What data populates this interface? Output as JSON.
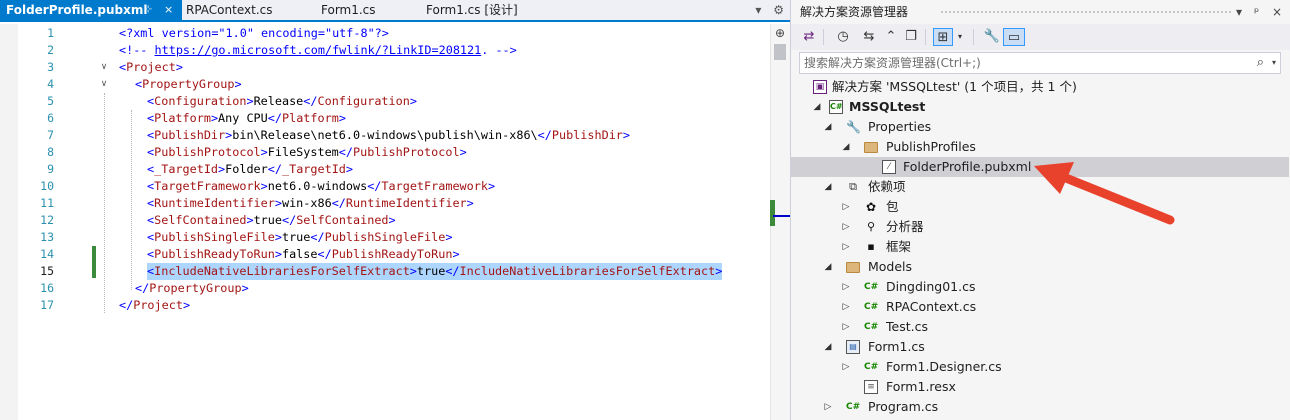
{
  "editor": {
    "tabs": [
      {
        "label": "FolderProfile.pubxml",
        "active": true
      },
      {
        "label": "RPAContext.cs",
        "active": false
      },
      {
        "label": "Form1.cs",
        "active": false
      },
      {
        "label": "Form1.cs [设计]",
        "active": false
      }
    ],
    "tab_pin": "⊹",
    "tab_close": "×",
    "tab_overflow": "▾",
    "tab_settings": "⚙",
    "split_button": "⊕",
    "current_line": 15,
    "line_numbers": [
      "1",
      "2",
      "3",
      "4",
      "5",
      "6",
      "7",
      "8",
      "9",
      "10",
      "11",
      "12",
      "13",
      "14",
      "15",
      "16",
      "17"
    ],
    "lines": {
      "l1_a": "<?xml version=\"1.0\" encoding=\"utf-8\"?>",
      "l2_a": "<!-- ",
      "l2_link": "https://go.microsoft.com/fwlink/?LinkID=208121",
      "l2_b": ". -->",
      "l3_a": "<",
      "l3_tag": "Project",
      "l3_b": ">",
      "l4_a": "<",
      "l4_tag": "PropertyGroup",
      "l4_b": ">",
      "l5_open": "Configuration",
      "l5_val": "Release",
      "l6_open": "Platform",
      "l6_val": "Any CPU",
      "l7_open": "PublishDir",
      "l7_val": "bin\\Release\\net6.0-windows\\publish\\win-x86\\",
      "l8_open": "PublishProtocol",
      "l8_val": "FileSystem",
      "l9_open": "_TargetId",
      "l9_val": "Folder",
      "l10_open": "TargetFramework",
      "l10_val": "net6.0-windows",
      "l11_open": "RuntimeIdentifier",
      "l11_val": "win-x86",
      "l12_open": "SelfContained",
      "l12_val": "true",
      "l13_open": "PublishSingleFile",
      "l13_val": "true",
      "l14_open": "PublishReadyToRun",
      "l14_val": "false",
      "l15_open": "IncludeNativeLibrariesForSelfExtract",
      "l15_val": "true",
      "l16_tag": "PropertyGroup",
      "l17_tag": "Project"
    }
  },
  "solution_explorer": {
    "title": "解决方案资源管理器",
    "title_buttons": [
      "▾",
      "ᵖ",
      "×"
    ],
    "toolbar_icons": [
      "solution-switch",
      "history",
      "sync",
      "collapse",
      "copy",
      "view-toggle",
      "properties",
      "preview"
    ],
    "toolbar_glyphs": [
      "⇄",
      "◷",
      "⇆",
      "⌃",
      "❐",
      "⊞",
      "🔧",
      "▭"
    ],
    "search_placeholder": "搜索解决方案资源管理器(Ctrl+;)",
    "search_icon": "⌕",
    "search_dropdown": "▾",
    "tree": [
      {
        "label": "解决方案 'MSSQLtest' (1 个项目，共 1 个)",
        "level": 0,
        "arrow": "",
        "icon": "sln"
      },
      {
        "label": "MSSQLtest",
        "level": 0,
        "arrow": "◢",
        "icon": "csproj",
        "bold": true
      },
      {
        "label": "Properties",
        "level": 1,
        "arrow": "◢",
        "icon": "wrench"
      },
      {
        "label": "PublishProfiles",
        "level": 2,
        "arrow": "◢",
        "icon": "folder"
      },
      {
        "label": "FolderProfile.pubxml",
        "level": 3,
        "arrow": "",
        "icon": "file",
        "selected": true
      },
      {
        "label": "依赖项",
        "level": 1,
        "arrow": "◢",
        "icon": "dep"
      },
      {
        "label": "包",
        "level": 2,
        "arrow": "▷",
        "icon": "pkg"
      },
      {
        "label": "分析器",
        "level": 2,
        "arrow": "▷",
        "icon": "analyzer"
      },
      {
        "label": "框架",
        "level": 2,
        "arrow": "▷",
        "icon": "framework"
      },
      {
        "label": "Models",
        "level": 1,
        "arrow": "◢",
        "icon": "folder"
      },
      {
        "label": "Dingding01.cs",
        "level": 2,
        "arrow": "▷",
        "icon": "cs"
      },
      {
        "label": "RPAContext.cs",
        "level": 2,
        "arrow": "▷",
        "icon": "cs"
      },
      {
        "label": "Test.cs",
        "level": 2,
        "arrow": "▷",
        "icon": "cs"
      },
      {
        "label": "Form1.cs",
        "level": 1,
        "arrow": "◢",
        "icon": "form"
      },
      {
        "label": "Form1.Designer.cs",
        "level": 2,
        "arrow": "▷",
        "icon": "cs"
      },
      {
        "label": "Form1.resx",
        "level": 2,
        "arrow": "",
        "icon": "file"
      },
      {
        "label": "Program.cs",
        "level": 1,
        "arrow": "▷",
        "icon": "cs"
      }
    ]
  },
  "annotation": {
    "arrow_color": "#e8412c"
  },
  "colors": {
    "accent": "#007acc",
    "xml_tag": "#a31515",
    "xml_punct": "#0000ff",
    "selection": "#add6ff"
  }
}
